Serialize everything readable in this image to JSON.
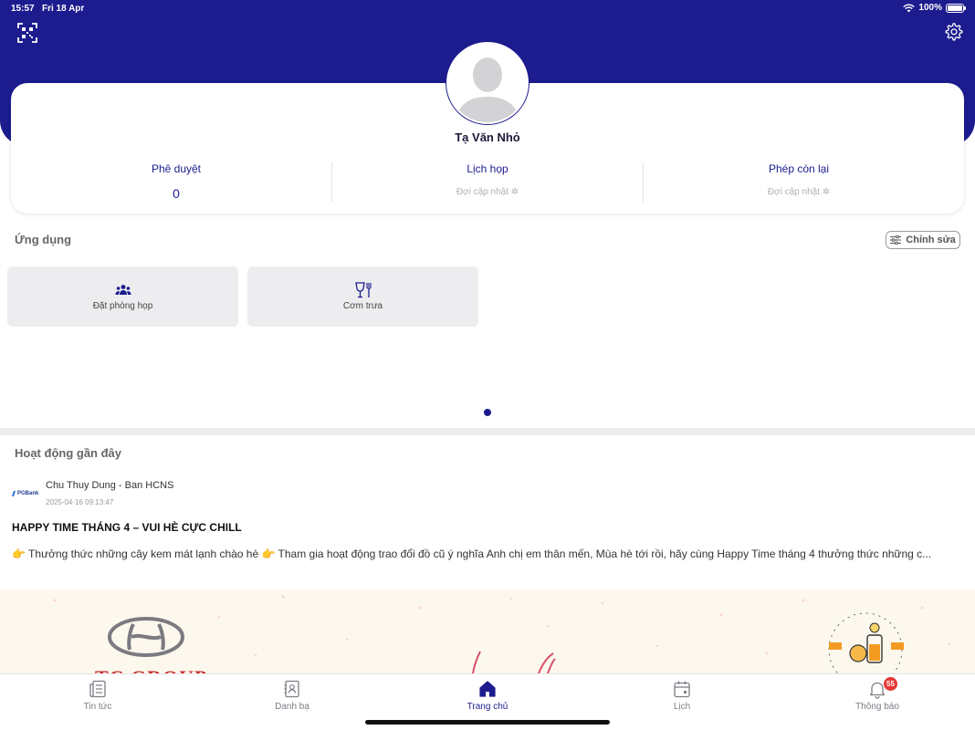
{
  "status_bar": {
    "time": "15:57",
    "date": "Fri 18 Apr",
    "battery": "100%"
  },
  "profile": {
    "name": "Tạ Văn Nhỏ"
  },
  "stats": [
    {
      "label": "Phê duyệt",
      "value": "0"
    },
    {
      "label": "Lịch họp",
      "value": "Đợi cập nhật"
    },
    {
      "label": "Phép còn lại",
      "value": "Đợi cập nhật"
    }
  ],
  "apps_section": {
    "title": "Ứng dụng",
    "edit_label": "Chỉnh sửa",
    "tiles": [
      {
        "label": "Đặt phòng họp",
        "icon": "people-icon"
      },
      {
        "label": "Cơm trưa",
        "icon": "utensils-icon"
      }
    ]
  },
  "activity": {
    "title": "Hoạt động gần đây",
    "post": {
      "logo_text": "PGBank",
      "author": "Chu Thuy Dung - Ban HCNS",
      "timestamp": "2025-04-16 09:13:47",
      "headline": "HAPPY TIME THÁNG 4 – VUI HÈ CỰC CHILL",
      "excerpt": "👉 Thưởng thức những cây kem mát lạnh chào hè  👉 Tham gia hoạt động trao đổi đồ cũ ý nghĩa  Anh chị em thân mến,  Mùa hè tới rồi, hãy cùng Happy Time tháng 4 thưởng thức những c...",
      "banner_brand": "TC GROUP",
      "banner_stamp": "HAPPY TIME"
    }
  },
  "tab_bar": {
    "tabs": [
      {
        "label": "Tin tức"
      },
      {
        "label": "Danh bạ"
      },
      {
        "label": "Trang chủ"
      },
      {
        "label": "Lịch"
      },
      {
        "label": "Thông báo",
        "badge": "55"
      }
    ]
  },
  "colors": {
    "primary": "#1c1c8f",
    "tile_bg": "#ededf0",
    "badge": "#e53935"
  }
}
